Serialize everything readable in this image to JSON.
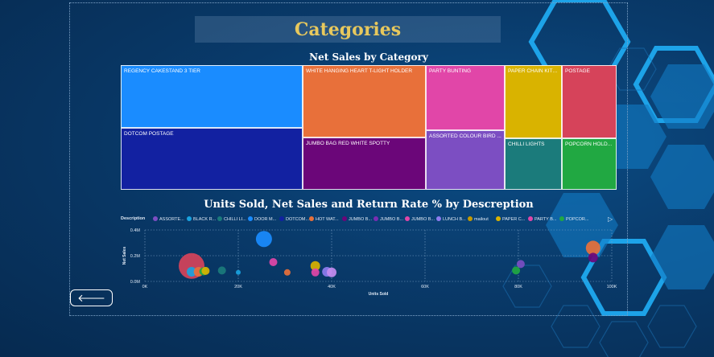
{
  "page": {
    "title": "Categories",
    "back_icon": "arrow-left-icon",
    "back_symbol": "🡐"
  },
  "treemap": {
    "title": "Net Sales by Category",
    "tiles": [
      {
        "label": "REGENCY CAKESTAND 3 TIER",
        "color": "#1a8cff"
      },
      {
        "label": "DOTCOM POSTAGE",
        "color": "#1221a1"
      },
      {
        "label": "WHITE HANGING HEART T-LIGHT HOLDER",
        "color": "#e8703a"
      },
      {
        "label": "JUMBO BAG RED WHITE SPOTTY",
        "color": "#6b0679"
      },
      {
        "label": "PARTY BUNTING",
        "color": "#e146a8"
      },
      {
        "label": "ASSORTED COLOUR BIRD ...",
        "color": "#7c4ec2"
      },
      {
        "label": "PAPER CHAIN KIT S...",
        "color": "#d9b300"
      },
      {
        "label": "CHILLI LIGHTS",
        "color": "#1b7b7b"
      },
      {
        "label": "POSTAGE",
        "color": "#d6435a"
      },
      {
        "label": "POPCORN HOLD...",
        "color": "#21a842"
      }
    ]
  },
  "scatter": {
    "title": "Units Sold, Net Sales and Return Rate % by Descreption",
    "legend_title": "Description",
    "legend": [
      {
        "label": "ASSORTE...",
        "color": "#7c4ec2"
      },
      {
        "label": "BLACK R...",
        "color": "#19a3e0"
      },
      {
        "label": "CHILLI LI...",
        "color": "#1b7b7b"
      },
      {
        "label": "DOOR M...",
        "color": "#1a8cff"
      },
      {
        "label": "DOTCOM...",
        "color": "#1221a1"
      },
      {
        "label": "HOT WAT...",
        "color": "#e8703a"
      },
      {
        "label": "JUMBO B...",
        "color": "#6b0679"
      },
      {
        "label": "JUMBO B...",
        "color": "#7a2db3"
      },
      {
        "label": "JUMBO B...",
        "color": "#e146a8"
      },
      {
        "label": "LUNCH B...",
        "color": "#8e7cf0"
      },
      {
        "label": "mailout",
        "color": "#c59a00"
      },
      {
        "label": "PAPER C...",
        "color": "#d9b300"
      },
      {
        "label": "PARTY B...",
        "color": "#e146a8"
      },
      {
        "label": "POPCOR...",
        "color": "#21a842"
      }
    ],
    "legend_more": "▷",
    "x_label": "Units Sold",
    "y_label": "Net Sales",
    "x_ticks": [
      "0K",
      "20K",
      "40K",
      "60K",
      "80K",
      "100K"
    ],
    "y_ticks": [
      "0.0M",
      "0.2M",
      "0.4M"
    ]
  },
  "chart_data": {
    "type": "scatter",
    "title": "Units Sold, Net Sales and Return Rate % by Descreption",
    "xlabel": "Units Sold",
    "ylabel": "Net Sales",
    "xlim": [
      0,
      100000
    ],
    "ylim": [
      0,
      400000
    ],
    "points": [
      {
        "x": 10000,
        "y": 120000,
        "r": 16,
        "color": "#d6435a"
      },
      {
        "x": 10000,
        "y": 75000,
        "r": 6,
        "color": "#19a3e0"
      },
      {
        "x": 11500,
        "y": 75000,
        "r": 6,
        "color": "#e8703a"
      },
      {
        "x": 12500,
        "y": 78000,
        "r": 5,
        "color": "#21a842"
      },
      {
        "x": 13000,
        "y": 82000,
        "r": 5,
        "color": "#d9b300"
      },
      {
        "x": 16500,
        "y": 85000,
        "r": 5,
        "color": "#1b7b7b"
      },
      {
        "x": 20000,
        "y": 70000,
        "r": 3,
        "color": "#19a3e0"
      },
      {
        "x": 25500,
        "y": 330000,
        "r": 10,
        "color": "#1a8cff"
      },
      {
        "x": 27500,
        "y": 150000,
        "r": 5,
        "color": "#e146a8"
      },
      {
        "x": 30500,
        "y": 70000,
        "r": 4,
        "color": "#e8703a"
      },
      {
        "x": 36500,
        "y": 120000,
        "r": 6,
        "color": "#d9b300"
      },
      {
        "x": 36500,
        "y": 70000,
        "r": 5,
        "color": "#e146a8"
      },
      {
        "x": 39000,
        "y": 75000,
        "r": 6,
        "color": "#8e7cf0"
      },
      {
        "x": 40000,
        "y": 70000,
        "r": 6,
        "color": "#c58cf0"
      },
      {
        "x": 79500,
        "y": 85000,
        "r": 5,
        "color": "#21a842"
      },
      {
        "x": 80500,
        "y": 135000,
        "r": 5,
        "color": "#7c4ec2"
      },
      {
        "x": 96000,
        "y": 260000,
        "r": 9,
        "color": "#e8703a"
      },
      {
        "x": 96000,
        "y": 185000,
        "r": 6,
        "color": "#6b0679"
      }
    ]
  }
}
